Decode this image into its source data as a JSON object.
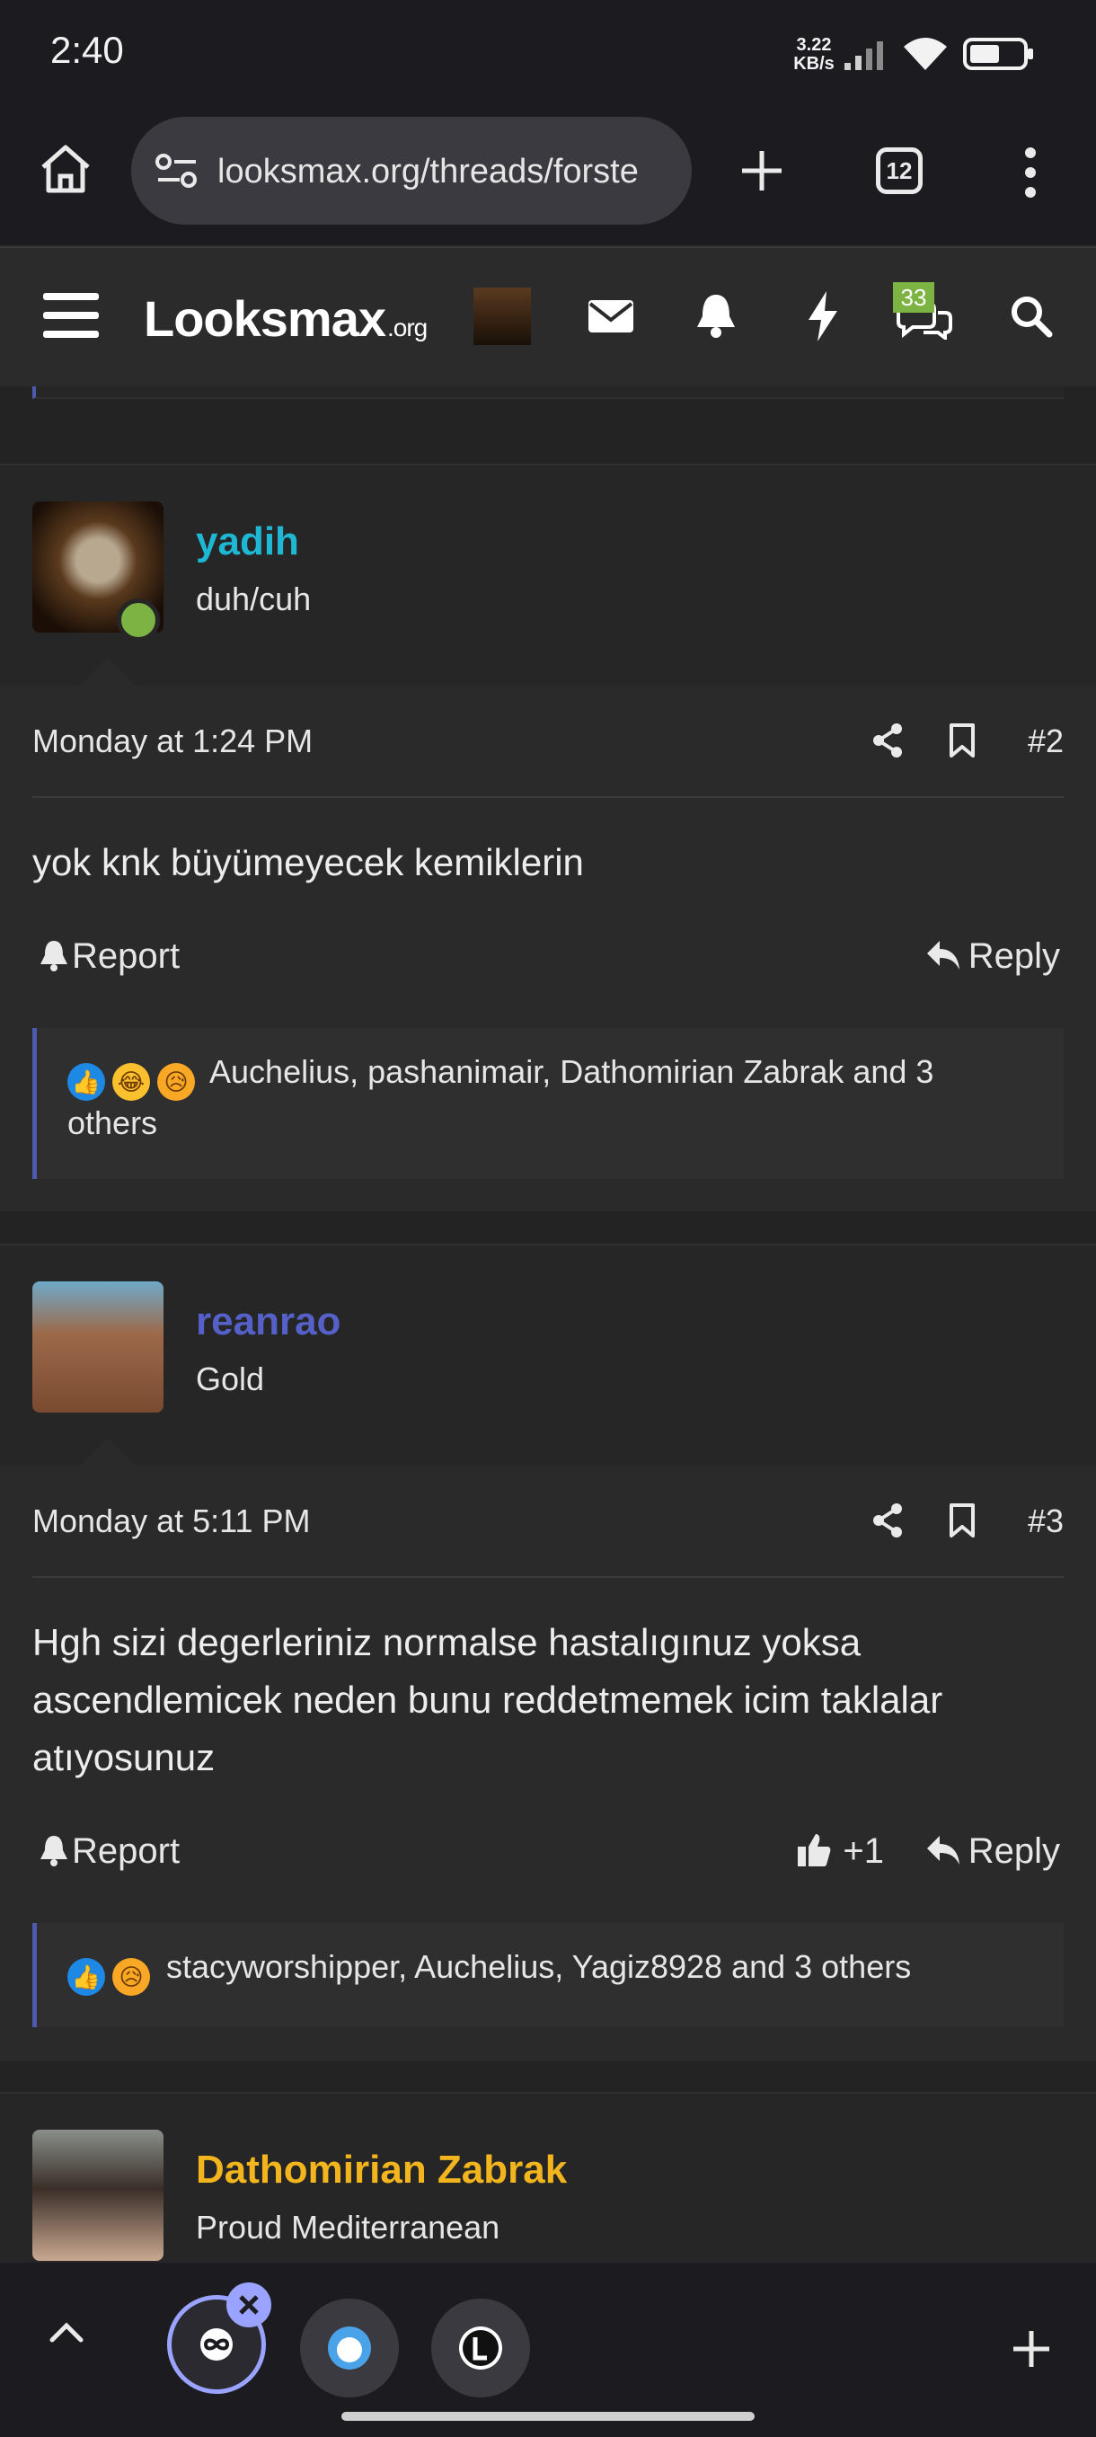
{
  "status": {
    "time": "2:40",
    "net_speed": "3.22",
    "net_unit": "KB/s"
  },
  "browser": {
    "url": "looksmax.org/threads/forste",
    "tab_count": "12"
  },
  "site": {
    "logo_main": "Looksmax",
    "logo_suffix": ".org",
    "messages_badge": "33"
  },
  "posts": [
    {
      "username": "yadih",
      "username_color": "#1eb7d4",
      "user_title": "duh/cuh",
      "date": "Monday at 1:24 PM",
      "number": "#2",
      "body": "yok knk büyümeyecek kemiklerin",
      "report_label": "Report",
      "reply_label": "Reply",
      "reactions_text": "Auchelius, pashanimair, Dathomirian Zabrak and 3 others"
    },
    {
      "username": "reanrao",
      "username_color": "#5560c8",
      "user_title": "Gold",
      "date": "Monday at 5:11 PM",
      "number": "#3",
      "body": "Hgh sizi degerleriniz normalse hastalıgınuz yoksa ascendlemicek neden bunu reddetmemek icim taklalar atıyosunuz",
      "report_label": "Report",
      "like_label": "+1",
      "reply_label": "Reply",
      "reactions_text": "stacyworshipper, Auchelius, Yagiz8928 and 3 others"
    },
    {
      "username": "Dathomirian Zabrak",
      "username_color": "#f2b51d",
      "user_title": "Proud Mediterranean"
    }
  ],
  "icons": {
    "status": [
      "signal-icon",
      "wifi-icon",
      "battery-icon"
    ],
    "browser": [
      "home-icon",
      "site-settings-icon",
      "new-tab-icon",
      "tab-switcher-icon",
      "more-menu-icon"
    ],
    "header": [
      "hamburger-menu-icon",
      "mail-icon",
      "bell-icon",
      "bolt-icon",
      "chat-icon",
      "search-icon"
    ],
    "post": [
      "share-icon",
      "bookmark-icon",
      "report-bell-icon",
      "reply-arrow-icon",
      "thumbs-up-icon"
    ],
    "bottom": [
      "chevron-up-icon",
      "close-icon",
      "plus-icon"
    ]
  },
  "colors": {
    "accent_border": "#4c5bb0",
    "online": "#7cb342"
  }
}
